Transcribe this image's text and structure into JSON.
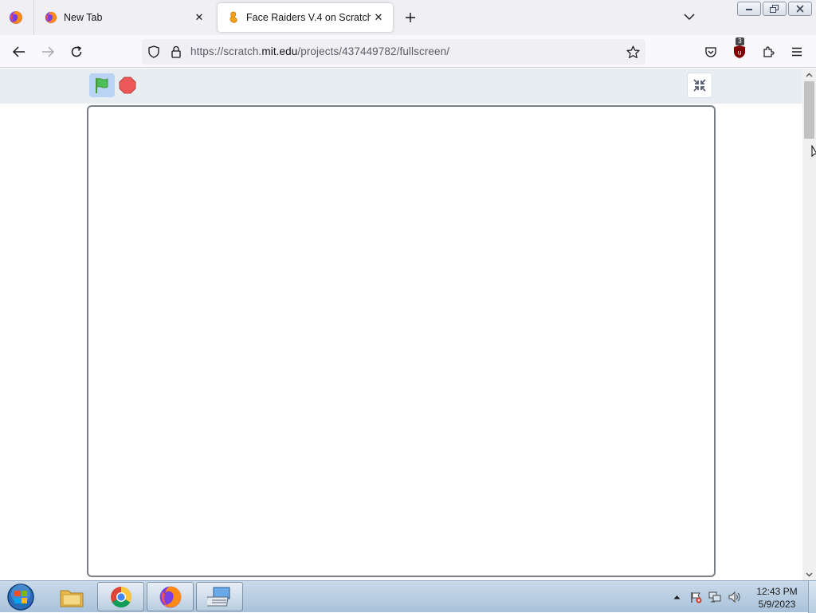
{
  "browser": {
    "tabs": [
      {
        "title": "New Tab",
        "icon": "firefox-icon",
        "active": false
      },
      {
        "title": "Face Raiders V.4 on Scratch",
        "icon": "scratch-cat-icon",
        "active": true
      }
    ],
    "close_glyph": "✕",
    "url": {
      "prefix": "https://scratch.",
      "domain": "mit.edu",
      "path": "/projects/437449782/fullscreen/"
    },
    "extension_badge": "3"
  },
  "scratch": {
    "green_flag_icon": "green-flag-icon",
    "stop_icon": "stop-sign-icon",
    "exit_fullscreen_icon": "unfullscreen-icon"
  },
  "taskbar": {
    "clock_time": "12:43 PM",
    "clock_date": "5/9/2023"
  },
  "colors": {
    "flag_green": "#4cbf56",
    "stop_red": "#ec5959",
    "scratch_menu_bg": "#e8edf1",
    "stage_border": "#7a7f85"
  }
}
